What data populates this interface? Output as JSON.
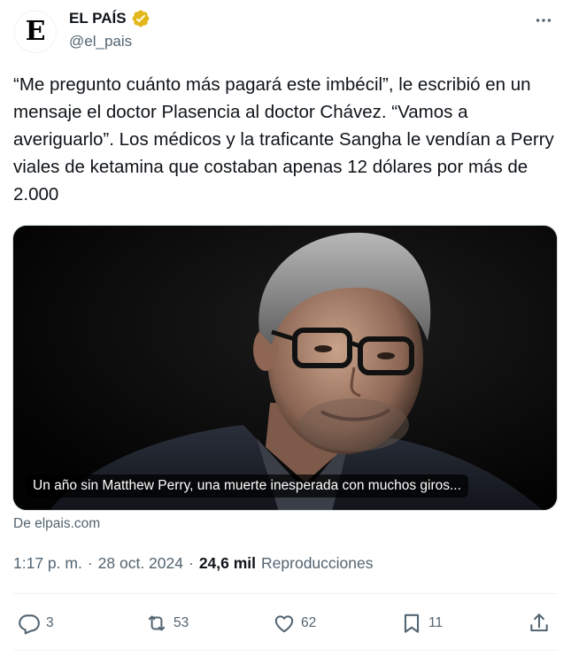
{
  "author": {
    "avatar_letter": "E",
    "name": "EL PAÍS",
    "handle": "@el_pais",
    "verified_color": "#e2b719"
  },
  "tweet": {
    "text": "“Me pregunto cuánto más pagará este imbécil”, le escribió en un mensaje el doctor Plasencia al doctor Chávez. “Vamos a averiguarlo”. Los médicos y la traficante Sangha le vendían a Perry viales de ketamina que costaban apenas 12 dólares por más de 2.000"
  },
  "card": {
    "caption": "Un año sin Matthew Perry, una muerte inesperada con muchos giros...",
    "source": "De elpais.com"
  },
  "meta": {
    "time": "1:17 p. m.",
    "date": "28 oct. 2024",
    "views_count": "24,6 mil",
    "views_label": "Reproducciones",
    "separator": "·"
  },
  "actions": {
    "replies": "3",
    "reposts": "53",
    "likes": "62",
    "bookmarks": "11"
  },
  "icons": {
    "more": "more-icon",
    "reply": "reply-icon",
    "repost": "repost-icon",
    "like": "heart-icon",
    "bookmark": "bookmark-icon",
    "share": "share-icon"
  },
  "colors": {
    "text": "#0f1419",
    "secondary": "#536471",
    "divider": "#eff3f4"
  }
}
